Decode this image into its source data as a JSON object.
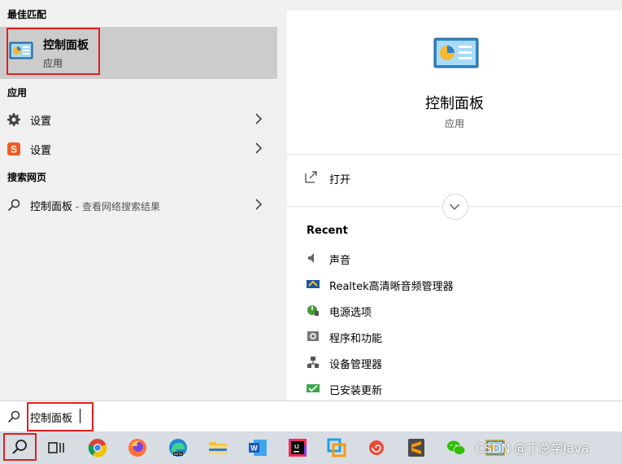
{
  "best_match": {
    "header": "最佳匹配",
    "title": "控制面板",
    "subtitle": "应用"
  },
  "apps": {
    "header": "应用",
    "items": [
      {
        "label": "设置",
        "icon": "gear-icon"
      },
      {
        "label": "设置",
        "icon": "sogou-settings-icon"
      }
    ]
  },
  "web": {
    "header": "搜索网页",
    "query": "控制面板",
    "suffix": " - 查看网络搜索结果"
  },
  "detail": {
    "title": "控制面板",
    "subtitle": "应用",
    "open_label": "打开",
    "recent_header": "Recent",
    "recent": [
      {
        "label": "声音",
        "icon": "speaker-icon"
      },
      {
        "label": "Realtek高清晰音频管理器",
        "icon": "realtek-icon"
      },
      {
        "label": "电源选项",
        "icon": "power-options-icon"
      },
      {
        "label": "程序和功能",
        "icon": "programs-icon"
      },
      {
        "label": "设备管理器",
        "icon": "device-manager-icon"
      },
      {
        "label": "已安装更新",
        "icon": "updates-icon"
      }
    ]
  },
  "search": {
    "value": "控制面板"
  },
  "taskbar": {
    "apps": [
      "search-icon",
      "task-view-icon",
      "chrome-icon",
      "firefox-icon",
      "edge-beta-icon",
      "file-explorer-icon",
      "word-icon",
      "intellij-icon",
      "app-icon",
      "snail-icon",
      "sublime-icon",
      "wechat-icon",
      "control-panel-icon"
    ],
    "watermark": "CSDN @丁总学Java"
  },
  "colors": {
    "highlight": "#e02020",
    "selected_bg": "#cccccc",
    "panel_bg": "#f0f0f0"
  }
}
